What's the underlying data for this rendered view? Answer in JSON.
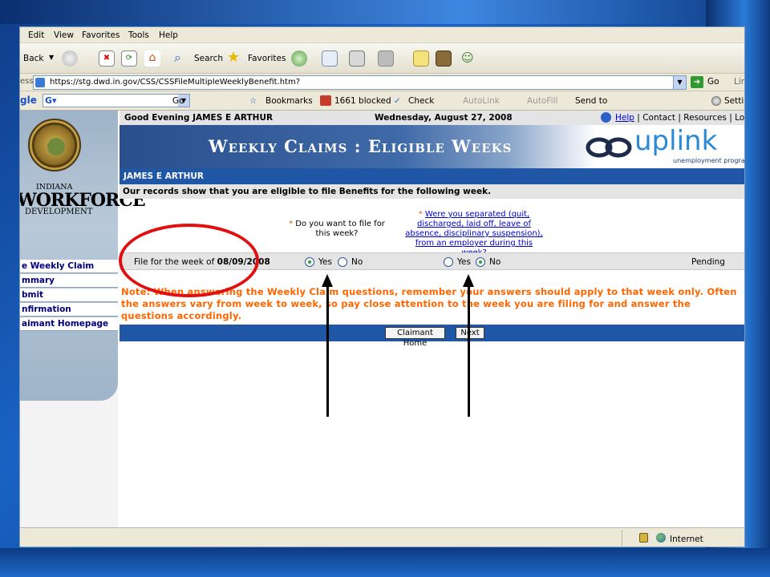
{
  "browser": {
    "menu": [
      "Edit",
      "View",
      "Favorites",
      "Tools",
      "Help"
    ],
    "toolbar": {
      "back": "Back",
      "search": "Search",
      "favorites": "Favorites"
    },
    "address": {
      "label": "ess",
      "url": "https://stg.dwd.in.gov/CSS/CSSFileMultipleWeeklyBenefit.htm?",
      "go": "Go",
      "links": "Lin"
    },
    "googlebar": {
      "logo": "gle",
      "go": "Go",
      "bookmarks": "Bookmarks",
      "blocked": "1661 blocked",
      "check": "Check",
      "autolink": "AutoLink",
      "autofill": "AutoFill",
      "sendto": "Send to",
      "settings": "Settir"
    },
    "status": {
      "zone": "Internet"
    }
  },
  "sidebar": {
    "logo": {
      "indiana": "INDIANA",
      "workforce": "WORKFORCE",
      "development": "DEVELOPMENT"
    },
    "links": [
      "e Weekly Claim",
      "mmary",
      "bmit",
      "nfirmation",
      "aimant Homepage"
    ]
  },
  "header": {
    "greeting": "Good Evening JAMES E ARTHUR",
    "date": "Wednesday, August 27, 2008",
    "links": {
      "help": "Help",
      "contact": "Contact",
      "resources": "Resources",
      "logoff": "Logoff"
    },
    "separator": "|"
  },
  "banner": {
    "title": "Weekly Claims : Eligible Weeks",
    "logo_text": "uplink",
    "logo_subtitle": "unemployment program"
  },
  "claimant": {
    "name": "JAMES E ARTHUR"
  },
  "records_text": "Our records show that you are eligible to file Benefits for the following week.",
  "questions": {
    "required_mark": "*",
    "q1": "Do you want to file for this week?",
    "q2": "Were you separated (quit, discharged, laid off, leave of absence, disciplinary suspension), from an employer during this week?"
  },
  "week": {
    "label": "File for the week of",
    "date": "08/09/2008",
    "q1_options": [
      "Yes",
      "No"
    ],
    "q1_selected": "Yes",
    "q2_options": [
      "Yes",
      "No"
    ],
    "q2_selected": "No",
    "status": "Pending"
  },
  "note": "Note: When answering the Weekly Claim questions, remember your answers should apply to that week only. Often the answers vary from week to week, so pay close attention to the week you are filing for and answer the questions accordingly.",
  "buttons": {
    "home": "Claimant Home",
    "next": "Next"
  },
  "colors": {
    "nav_blue": "#1f56a6",
    "note_orange": "#ff6600",
    "annotation_red": "#e01010"
  }
}
